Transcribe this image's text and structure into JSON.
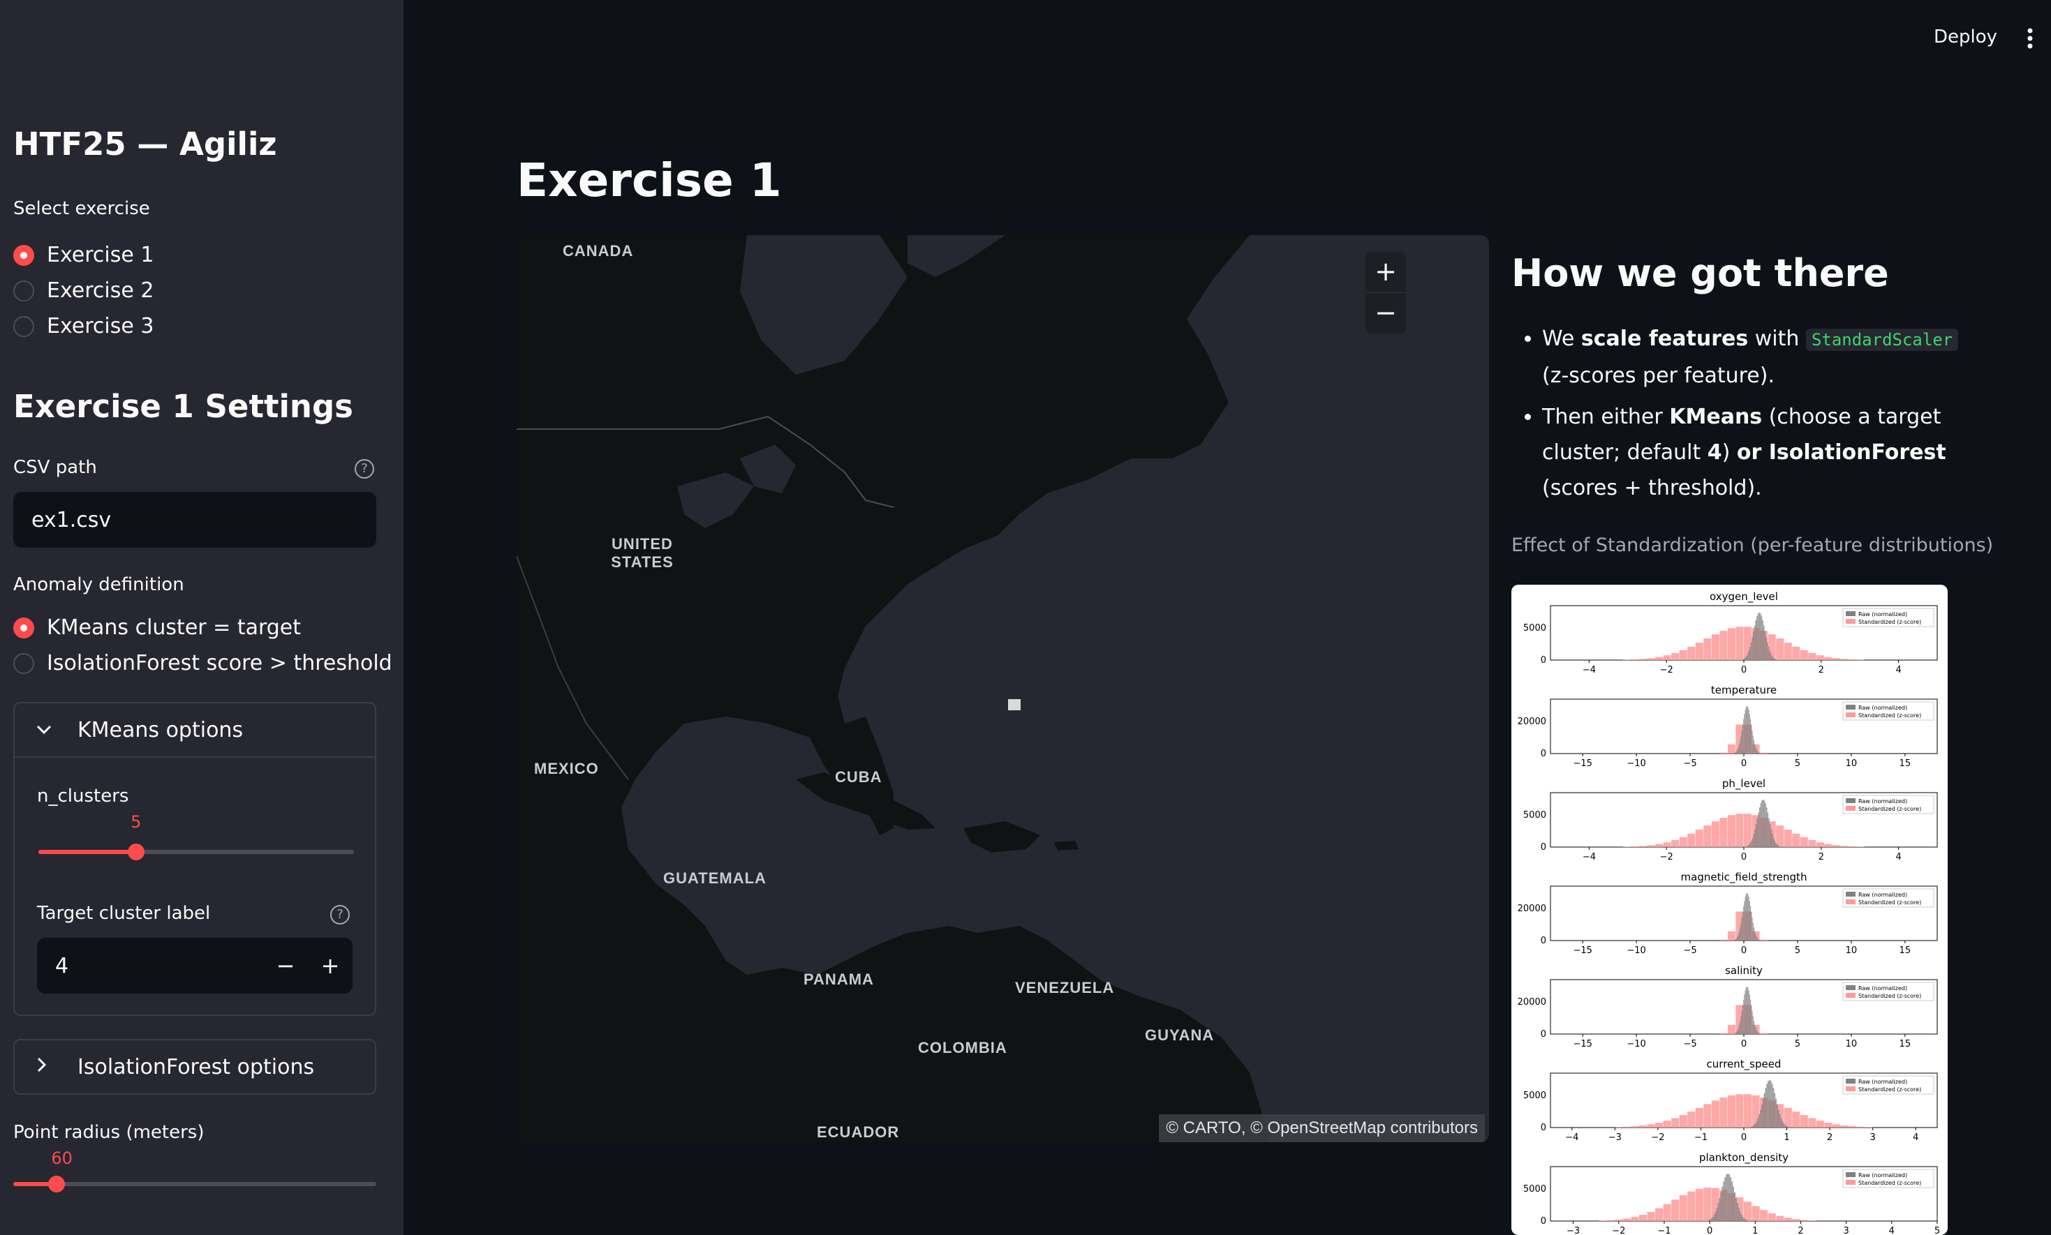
{
  "sidebar": {
    "app_title": "HTF25 — Agiliz",
    "exercise_label": "Select exercise",
    "exercises": [
      "Exercise 1",
      "Exercise 2",
      "Exercise 3"
    ],
    "selected_exercise": "Exercise 1",
    "settings_title": "Exercise 1 Settings",
    "csv_label": "CSV path",
    "csv_value": "ex1.csv",
    "anomaly_label": "Anomaly definition",
    "anomaly_options": [
      "KMeans cluster = target",
      "IsolationForest score > threshold"
    ],
    "selected_anomaly": "KMeans cluster = target",
    "kmeans_expander": "KMeans options",
    "n_clusters_label": "n_clusters",
    "n_clusters_value": "5",
    "n_clusters_fraction": 0.31,
    "target_label": "Target cluster label",
    "target_value": "4",
    "iforest_expander": "IsolationForest options",
    "radius_label": "Point radius (meters)",
    "radius_value": "60",
    "radius_fraction": 0.12
  },
  "header": {
    "deploy_label": "Deploy"
  },
  "main": {
    "title": "Exercise 1",
    "map": {
      "labels": [
        "CANADA",
        "UNITED STATES",
        "MEXICO",
        "CUBA",
        "GUATEMALA",
        "PANAMA",
        "VENEZUELA",
        "COLOMBIA",
        "GUYANA",
        "ECUADOR"
      ],
      "attribution": "© CARTO, © OpenStreetMap contributors",
      "zoom_in": "+",
      "zoom_out": "−"
    },
    "explainer": {
      "title": "How we got there",
      "b1_pre": "We ",
      "b1_bold": "scale features",
      "b1_mid": " with ",
      "b1_code": "StandardScaler",
      "b1_post": " (z-scores per feature).",
      "b2_pre": "Then either ",
      "b2_bold1": "KMeans",
      "b2_mid": " (choose a target cluster; default ",
      "b2_bold2": "4",
      "b2_mid2": ") ",
      "b2_bold3": "or IsolationForest",
      "b2_post": " (scores + threshold).",
      "caption": "Effect of Standardization (per-feature distributions)"
    }
  },
  "chart_data": {
    "type": "histogram",
    "legend": [
      "Raw (normalized)",
      "Standardized (z-score)"
    ],
    "colors": {
      "raw": "#808080",
      "standardized": "#ff9999"
    },
    "panels": [
      {
        "title": "oxygen_level",
        "ytick": "5000",
        "xticks": [
          "−4",
          "−2",
          "0",
          "2",
          "4"
        ],
        "xlim": [
          -5,
          5
        ],
        "raw_mean": 0.4,
        "raw_sd": 0.15,
        "std_sd": 1.0
      },
      {
        "title": "temperature",
        "ytick": "20000",
        "xticks": [
          "−15",
          "−10",
          "−5",
          "0",
          "5",
          "10",
          "15"
        ],
        "xlim": [
          -18,
          18
        ],
        "raw_mean": 0.3,
        "raw_sd": 0.4,
        "std_sd": 0.7
      },
      {
        "title": "ph_level",
        "ytick": "5000",
        "xticks": [
          "−4",
          "−2",
          "0",
          "2",
          "4"
        ],
        "xlim": [
          -5,
          5
        ],
        "raw_mean": 0.5,
        "raw_sd": 0.15,
        "std_sd": 1.0
      },
      {
        "title": "magnetic_field_strength",
        "ytick": "20000",
        "xticks": [
          "−15",
          "−10",
          "−5",
          "0",
          "5",
          "10",
          "15"
        ],
        "xlim": [
          -18,
          18
        ],
        "raw_mean": 0.3,
        "raw_sd": 0.4,
        "std_sd": 0.7
      },
      {
        "title": "salinity",
        "ytick": "20000",
        "xticks": [
          "−15",
          "−10",
          "−5",
          "0",
          "5",
          "10",
          "15"
        ],
        "xlim": [
          -18,
          18
        ],
        "raw_mean": 0.3,
        "raw_sd": 0.4,
        "std_sd": 0.7
      },
      {
        "title": "current_speed",
        "ytick": "5000",
        "xticks": [
          "−4",
          "−3",
          "−2",
          "−1",
          "0",
          "1",
          "2",
          "3",
          "4"
        ],
        "xlim": [
          -4.5,
          4.5
        ],
        "raw_mean": 0.6,
        "raw_sd": 0.15,
        "std_sd": 1.0
      },
      {
        "title": "plankton_density",
        "ytick": "5000",
        "xticks": [
          "−3",
          "−2",
          "−1",
          "0",
          "1",
          "2",
          "3",
          "4",
          "5"
        ],
        "xlim": [
          -3.5,
          5
        ],
        "raw_mean": 0.4,
        "raw_sd": 0.15,
        "std_sd": 0.8
      }
    ]
  }
}
